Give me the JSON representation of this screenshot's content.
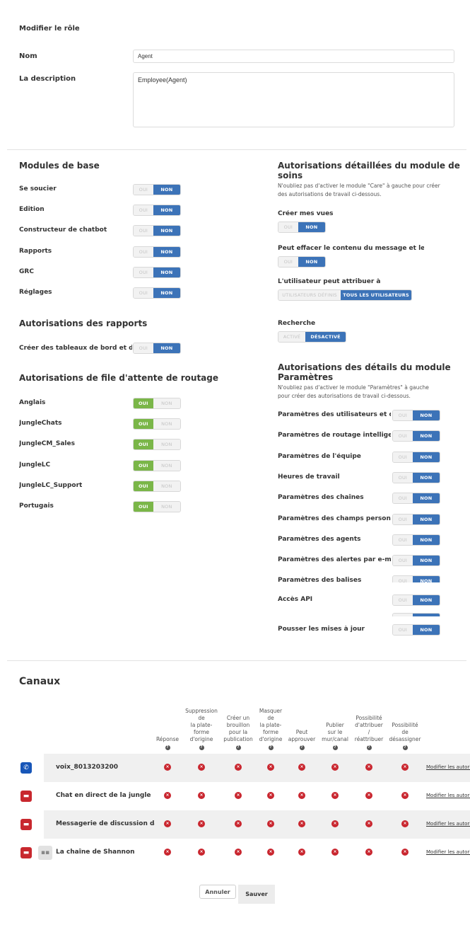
{
  "page": {
    "title": "Modifier le rôle",
    "name_label": "Nom",
    "name_value": "Agent",
    "description_label": "La description",
    "description_value": "Employee(Agent)"
  },
  "toggle_labels": {
    "yes": "OUI",
    "no": "NON"
  },
  "core_modules": {
    "title": "Modules de base",
    "items": [
      {
        "label": "Se soucier",
        "value": "NON"
      },
      {
        "label": "Édition",
        "value": "NON"
      },
      {
        "label": "Constructeur de chatbot",
        "value": "NON"
      },
      {
        "label": "Rapports",
        "value": "NON"
      },
      {
        "label": "GRC",
        "value": "NON"
      },
      {
        "label": "Réglages",
        "value": "NON"
      }
    ]
  },
  "report_permissions": {
    "title": "Autorisations des rapports",
    "items": [
      {
        "label": "Créer des tableaux de bord et des vues",
        "value": "NON"
      }
    ]
  },
  "routing_queue": {
    "title": "Autorisations de file d'attente de routage",
    "items": [
      {
        "label": "Anglais",
        "value": "OUI"
      },
      {
        "label": "JungleChats",
        "value": "OUI"
      },
      {
        "label": "JungleCM_Sales",
        "value": "OUI"
      },
      {
        "label": "JungleLC",
        "value": "OUI"
      },
      {
        "label": "JungleLC_Support",
        "value": "OUI"
      },
      {
        "label": "Portugais",
        "value": "OUI"
      }
    ]
  },
  "care_module": {
    "title_line1": "Autorisations détaillées du module de",
    "title_line2": "soins",
    "note_line1": "N'oubliez pas d'activer le module \"Care\" à gauche pour créer",
    "note_line2": "des autorisations de travail ci-dessous.",
    "create_views": {
      "label": "Créer mes vues",
      "value": "NON"
    },
    "erase_content": {
      "label": "Peut effacer le contenu du message et le nom",
      "value": "NON"
    },
    "assign_to": {
      "label": "L'utilisateur peut attribuer à",
      "options": [
        "UTILISATEURS DÉFINIS",
        "TOUS LES UTILISATEURS"
      ],
      "value": "TOUS LES UTILISATEURS"
    },
    "search": {
      "label": "Recherche",
      "options": [
        "ACTIVÉ",
        "DÉSACTIVÉ"
      ],
      "value": "DÉSACTIVÉ"
    }
  },
  "settings_module": {
    "title_line1": "Autorisations des détails du module",
    "title_line2": "Paramètres",
    "note_line1": "N'oubliez pas d'activer le module \"Paramètres\" à gauche",
    "note_line2": "pour créer des autorisations de travail ci-dessous.",
    "items": [
      {
        "label": "Paramètres des utilisateurs et des",
        "value": "NON"
      },
      {
        "label": "Paramètres de routage intelligents",
        "value": "NON"
      },
      {
        "label": "Paramètres de l'équipe",
        "value": "NON"
      },
      {
        "label": "Heures de travail",
        "value": "NON"
      },
      {
        "label": "Paramètres des chaînes",
        "value": "NON"
      },
      {
        "label": "Paramètres des champs personnalisés",
        "value": "NON"
      },
      {
        "label": "Paramètres des agents",
        "value": "NON"
      },
      {
        "label": "Paramètres des alertes par e-mail",
        "value": "NON"
      },
      {
        "label": "Paramètres des balises",
        "value": "NON"
      },
      {
        "label": "Accès API",
        "value": "NON"
      },
      {
        "label": "",
        "value": "NON"
      },
      {
        "label": "Pousser les mises à jour",
        "value": "NON"
      }
    ]
  },
  "channels": {
    "title": "Canaux",
    "columns": [
      "Réponse",
      "Suppression de la plate-forme d'origine",
      "Créer un brouillon pour la publication",
      "Masquer de la plate-forme d'origine",
      "Peut approuver",
      "Publier sur le mur/canal",
      "Possibilité d'attribuer / réattribuer",
      "Possibilité de désassigner"
    ],
    "column_lines": [
      [
        "Réponse"
      ],
      [
        "Suppression",
        "de",
        "la plate-",
        "forme",
        "d'origine"
      ],
      [
        "Créer un",
        "brouillon",
        "pour la",
        "publication"
      ],
      [
        "Masquer",
        "de",
        "la plate-",
        "forme",
        "d'origine"
      ],
      [
        "Peut",
        "approuver"
      ],
      [
        "Publier",
        "sur le",
        "mur/canal"
      ],
      [
        "Possibilité",
        "d'attribuer",
        "/",
        "réattribuer"
      ],
      [
        "Possibilité",
        "de",
        "désassigner"
      ]
    ],
    "rows": [
      {
        "icon": "phone-icon",
        "name": "voix_8013203200",
        "permissions": [
          false,
          false,
          false,
          false,
          false,
          false,
          false,
          false
        ],
        "edit_link": "Modifier les autorisations"
      },
      {
        "icon": "chat-bubble-icon",
        "name": "Chat en direct de la jungle",
        "permissions": [
          false,
          false,
          false,
          false,
          false,
          false,
          false,
          false
        ],
        "edit_link": "Modifier les autorisations"
      },
      {
        "icon": "chat-bubble-icon",
        "name": "Messagerie de discussion dans la jungle",
        "permissions": [
          false,
          false,
          false,
          false,
          false,
          false,
          false,
          false
        ],
        "edit_link": "Modifier les autorisations"
      },
      {
        "icon": "chat-bubble-icon",
        "sub_icon": "conversation-icon",
        "name": "La chaîne de Shannon",
        "permissions": [
          false,
          false,
          false,
          false,
          false,
          false,
          false,
          false
        ],
        "edit_link": "Modifier les autorisations"
      }
    ]
  },
  "actions": {
    "cancel": "Annuler",
    "save": "Sauver"
  },
  "colors": {
    "toggle_on_blue": "#3c73b8",
    "toggle_on_green": "#7ab648",
    "deny_red": "#c9262f",
    "voice_blue": "#1756b8",
    "chat_red": "#c8282e"
  }
}
